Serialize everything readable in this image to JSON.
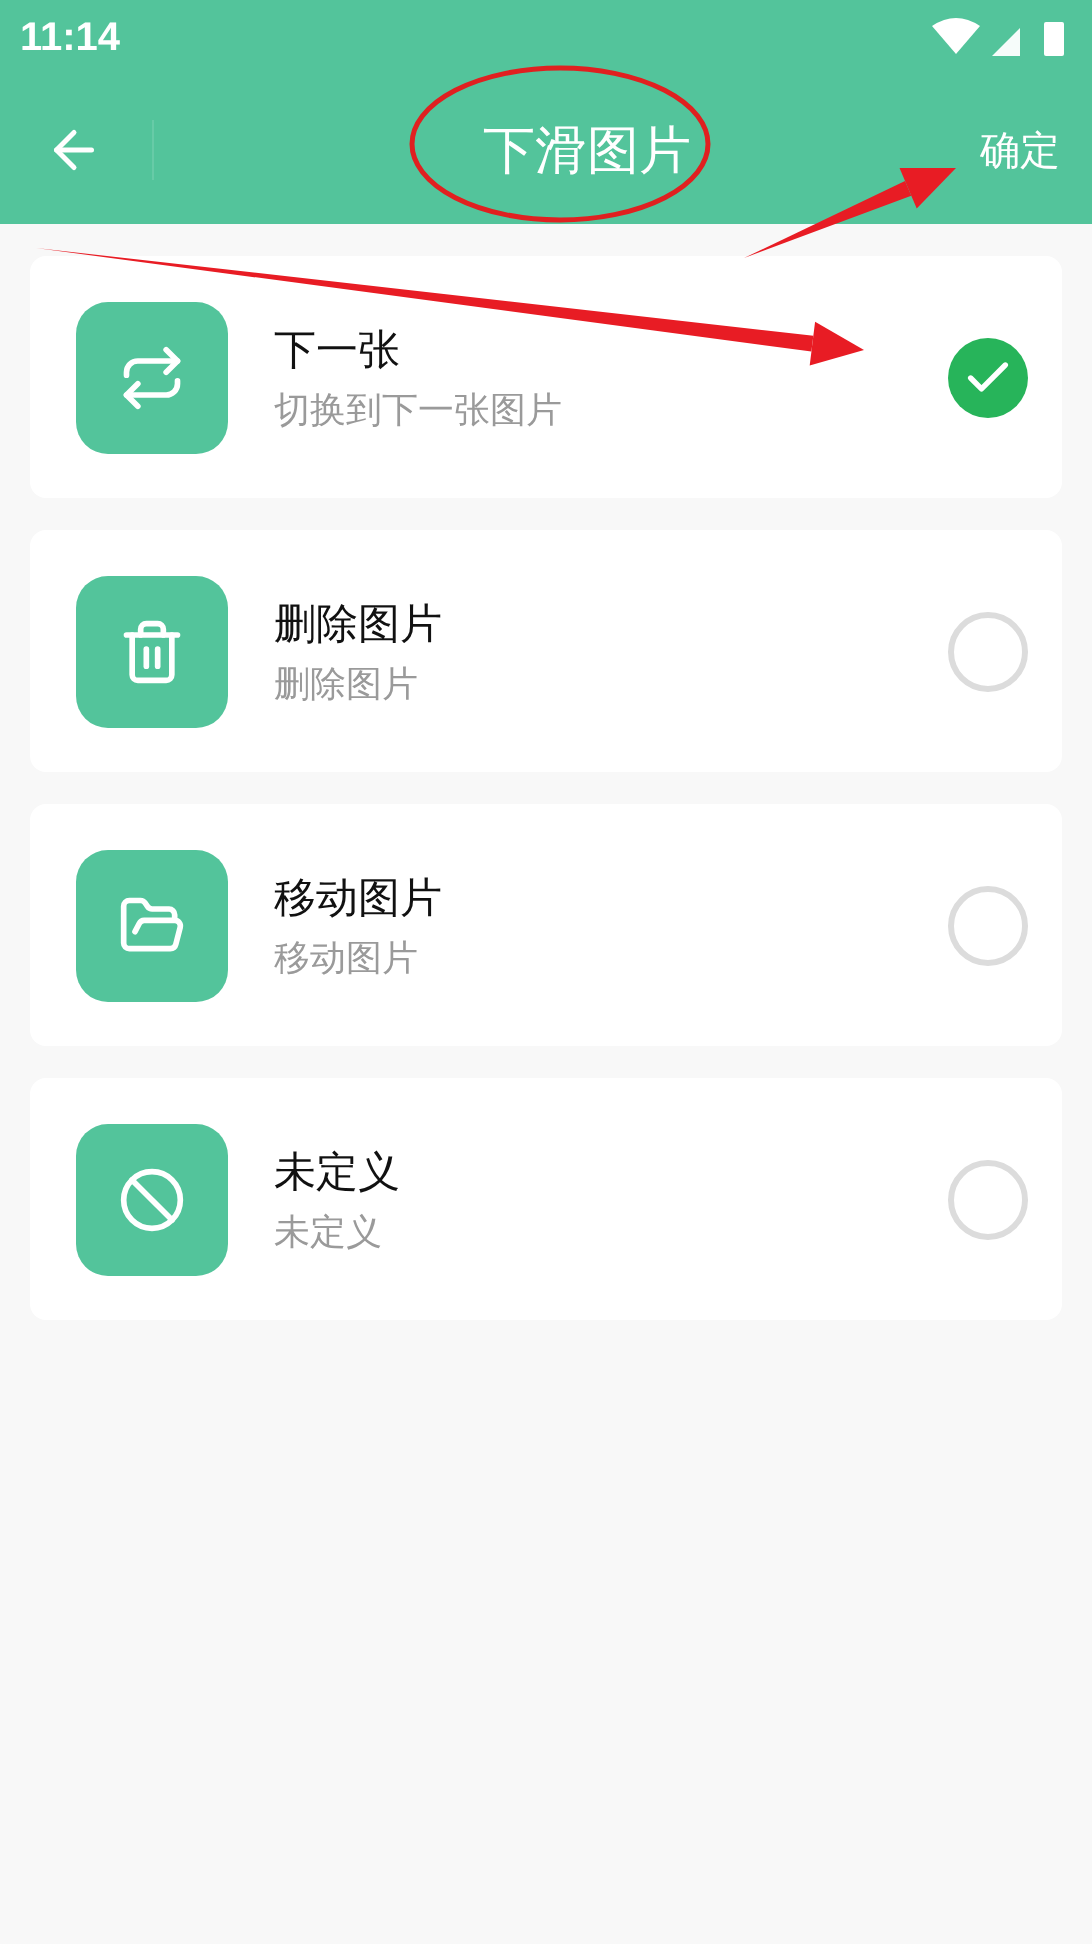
{
  "status_bar": {
    "time": "11:14"
  },
  "header": {
    "title": "下滑图片",
    "confirm": "确定"
  },
  "options": [
    {
      "title": "下一张",
      "subtitle": "切换到下一张图片",
      "selected": true
    },
    {
      "title": "删除图片",
      "subtitle": "删除图片",
      "selected": false
    },
    {
      "title": "移动图片",
      "subtitle": "移动图片",
      "selected": false
    },
    {
      "title": "未定义",
      "subtitle": "未定义",
      "selected": false
    }
  ],
  "annotations": [
    {
      "kind": "ellipse"
    },
    {
      "kind": "arrow"
    },
    {
      "kind": "arrow"
    }
  ]
}
